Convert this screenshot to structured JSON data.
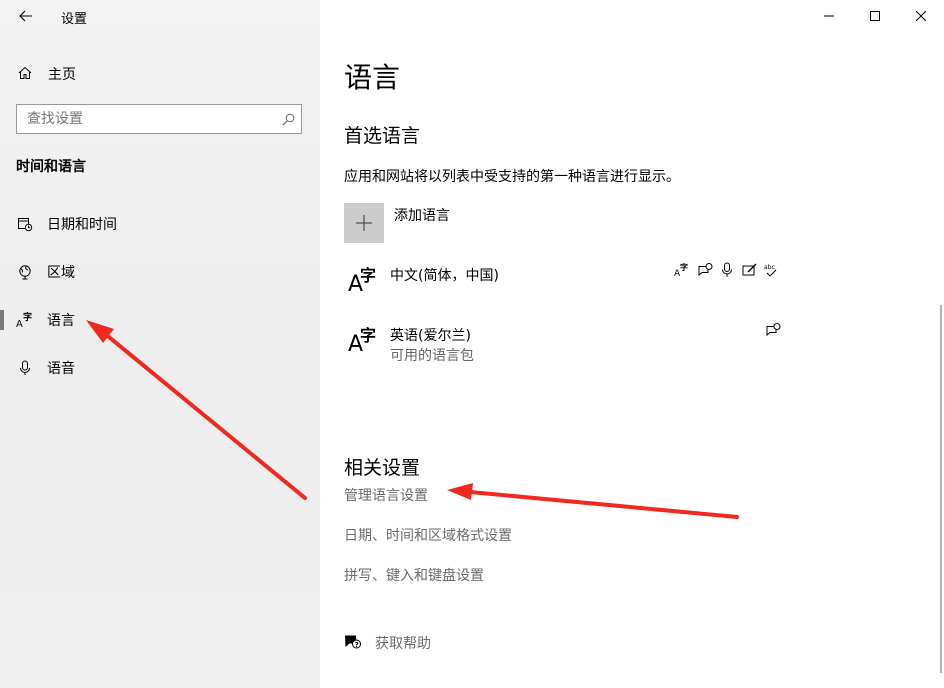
{
  "window": {
    "title": "设置"
  },
  "sidebar": {
    "home_label": "主页",
    "search_placeholder": "查找设置",
    "section_title": "时间和语言",
    "items": [
      {
        "label": "日期和时间",
        "icon": "calendar-clock-icon"
      },
      {
        "label": "区域",
        "icon": "globe-icon"
      },
      {
        "label": "语言",
        "icon": "language-icon",
        "selected": true
      },
      {
        "label": "语音",
        "icon": "microphone-icon"
      }
    ]
  },
  "main": {
    "title": "语言",
    "preferred": {
      "heading": "首选语言",
      "description": "应用和网站将以列表中受支持的第一种语言进行显示。",
      "add_label": "添加语言",
      "languages": [
        {
          "name": "中文(简体，中国)",
          "status": "",
          "capabilities": [
            "display-icon",
            "speech-icon",
            "voice-icon",
            "handwriting-icon",
            "spellcheck-icon"
          ]
        },
        {
          "name": "英语(爱尔兰)",
          "status": "可用的语言包",
          "capabilities": [
            "speech-icon"
          ]
        }
      ]
    },
    "related": {
      "heading": "相关设置",
      "links": [
        "管理语言设置",
        "日期、时间和区域格式设置",
        "拼写、键入和键盘设置"
      ]
    },
    "help_label": "获取帮助"
  },
  "colors": {
    "accent": "#7a7a7a",
    "annotation_arrow": "#f0281e"
  }
}
